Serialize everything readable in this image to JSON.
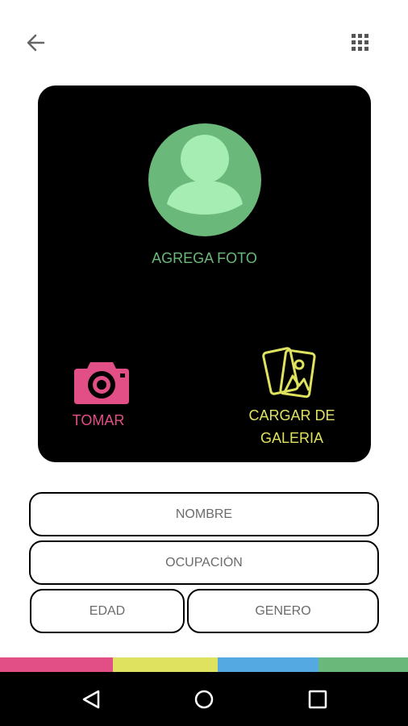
{
  "header": {
    "back_icon": "arrow-left-icon",
    "menu_icon": "grid-icon"
  },
  "photo_card": {
    "add_photo_label": "AGREGA FOTO",
    "take_label": "TOMAR",
    "gallery_label_line1": "CARGAR DE",
    "gallery_label_line2": "GALERIA"
  },
  "form": {
    "name_placeholder": "NOMBRE",
    "occupation_placeholder": "OCUPACIÓN",
    "age_placeholder": "EDAD",
    "gender_placeholder": "GENERO"
  },
  "colors": {
    "card_bg": "#000000",
    "avatar_green": "#6ab87a",
    "take_pink": "#e24f86",
    "gallery_yellow": "#dfe25f",
    "stripe": [
      "#e24f86",
      "#dfe25f",
      "#55a9e2",
      "#6ab87a"
    ]
  },
  "navbar": {
    "icons": [
      "nav-back-icon",
      "nav-home-icon",
      "nav-recents-icon"
    ]
  }
}
